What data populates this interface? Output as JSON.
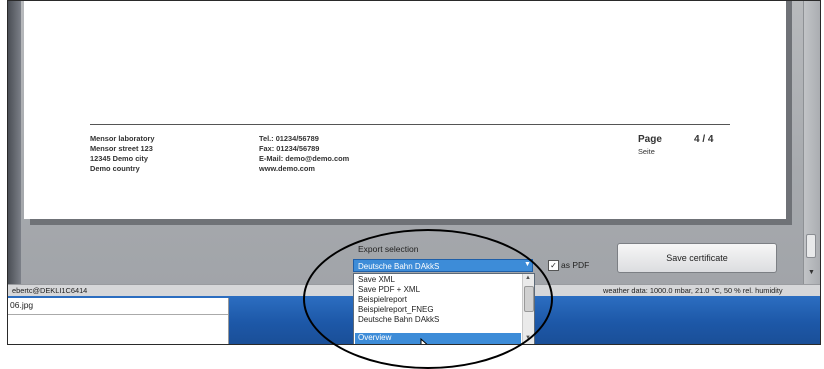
{
  "document_footer": {
    "company": {
      "name": "Mensor laboratory",
      "street": "Mensor street 123",
      "city": "12345 Demo city",
      "country": "Demo country"
    },
    "contact": {
      "tel": "Tel.: 01234/56789",
      "fax": "Fax: 01234/56789",
      "email": "E-Mail: demo@demo.com",
      "web": "www.demo.com"
    },
    "page": {
      "label": "Page",
      "label_de": "Seite",
      "number": "4 / 4"
    }
  },
  "export": {
    "label": "Export selection",
    "selected": "Deutsche Bahn DAkkS",
    "options": [
      "Save XML",
      "Save PDF + XML",
      "Beispielreport",
      "Beispielreport_FNEG",
      "Deutsche Bahn DAkkS",
      "Overview"
    ],
    "highlighted_option": "Overview",
    "as_pdf_label": "as PDF",
    "as_pdf_checked": true,
    "as_pdf_mark": "✓"
  },
  "save_button": {
    "label": "Save certificate"
  },
  "status_bar": {
    "left": "ebertc@DEKLI1C6414",
    "right": "weather data: 1000.0 mbar, 21.0 °C, 50 % rel. humidity"
  },
  "taskbar": {
    "file_name": "06.jpg"
  },
  "colors": {
    "accent": "#3d8cd8",
    "taskbar": "#2165b5",
    "background": "#a9acb0"
  },
  "icons": {
    "dropdown_arrow": "chevron-down-icon",
    "scroll_up": "arrow-up-icon",
    "scroll_down": "arrow-down-icon",
    "cursor": "mouse-pointer-icon"
  }
}
